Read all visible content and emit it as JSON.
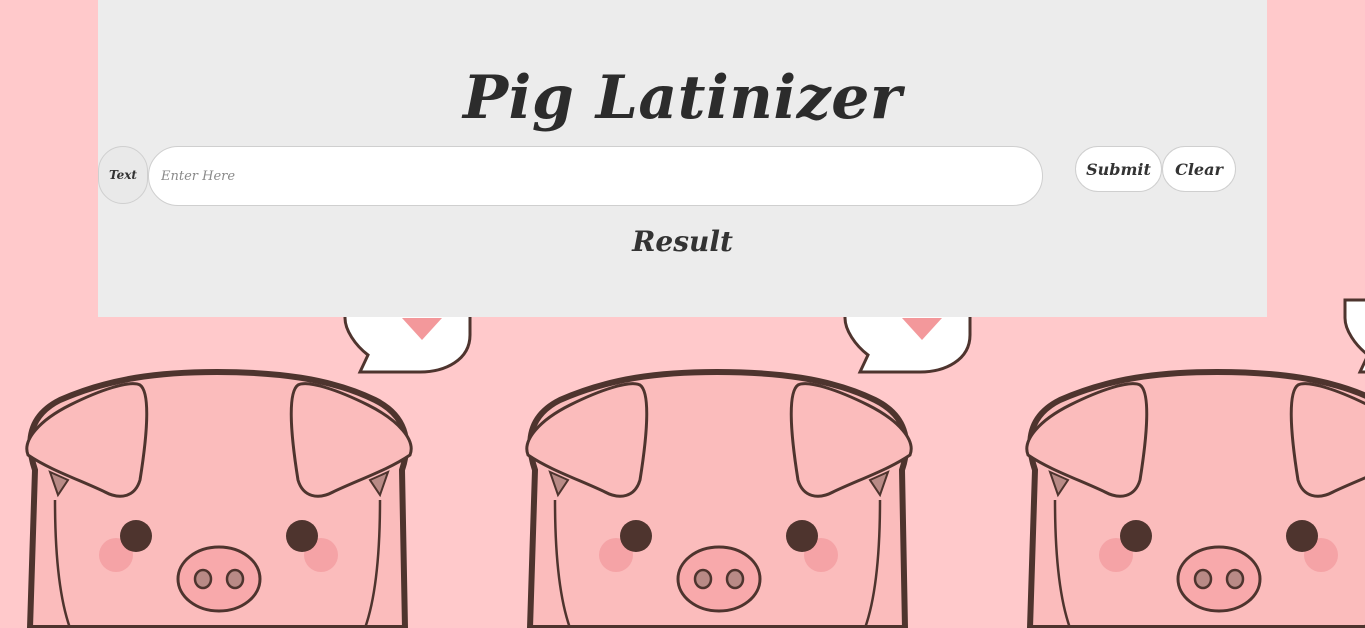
{
  "page": {
    "title": "Pig Latinizer",
    "background_color": "#ffc9cb",
    "panel_color": "#ececec"
  },
  "form": {
    "input_label": "Text",
    "input_placeholder": "Enter Here",
    "input_value": "",
    "submit_label": "Submit",
    "clear_label": "Clear"
  },
  "result": {
    "heading": "Result",
    "text": ""
  },
  "background": {
    "pattern": "pig-face-with-heart-speech-bubble",
    "pig_color": "#fbbcbc",
    "outline_color": "#4e342e"
  }
}
